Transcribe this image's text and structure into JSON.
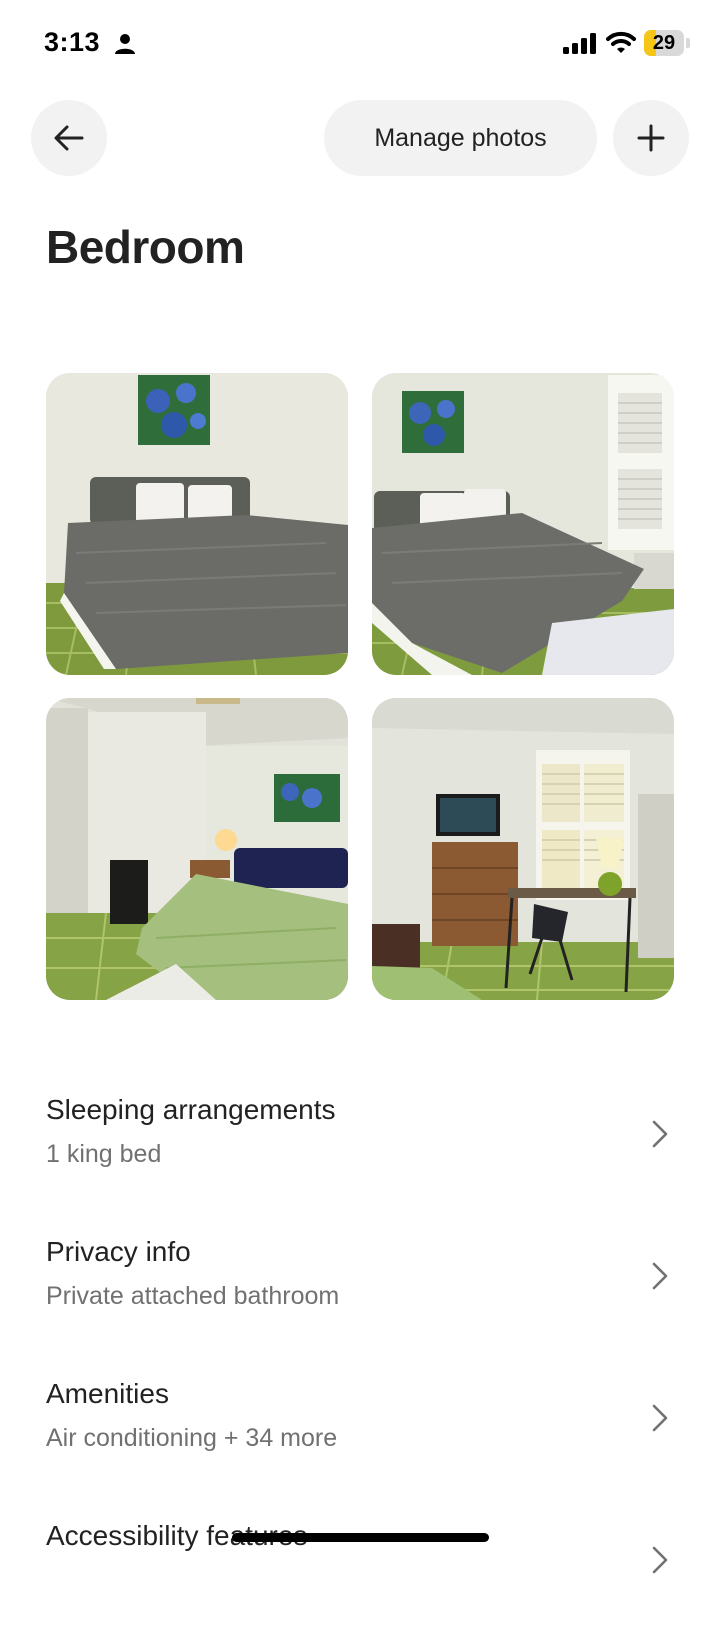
{
  "status_bar": {
    "time": "3:13",
    "battery_level": "29",
    "battery_fraction": 0.29,
    "battery_color": "#f5c518"
  },
  "header": {
    "back_icon": "arrow-left-icon",
    "manage_photos_label": "Manage photos",
    "add_icon": "plus-icon"
  },
  "page": {
    "title": "Bedroom"
  },
  "photos": [
    {
      "name": "bedroom-photo-1",
      "subject": "bed with gray cover and blue floral painting"
    },
    {
      "name": "bedroom-photo-2",
      "subject": "bed near window with shutters"
    },
    {
      "name": "bedroom-photo-3",
      "subject": "room view with green bedspread and lamp"
    },
    {
      "name": "bedroom-photo-4",
      "subject": "dresser with TV, desk and chair"
    }
  ],
  "rows": [
    {
      "title": "Sleeping arrangements",
      "subtitle": "1 king bed"
    },
    {
      "title": "Privacy info",
      "subtitle": "Private attached bathroom"
    },
    {
      "title": "Amenities",
      "subtitle": "Air conditioning + 34 more"
    },
    {
      "title": "Accessibility features",
      "subtitle": ""
    }
  ],
  "colors": {
    "text_primary": "#222222",
    "text_secondary": "#717171",
    "button_bg": "#f2f2f2"
  }
}
